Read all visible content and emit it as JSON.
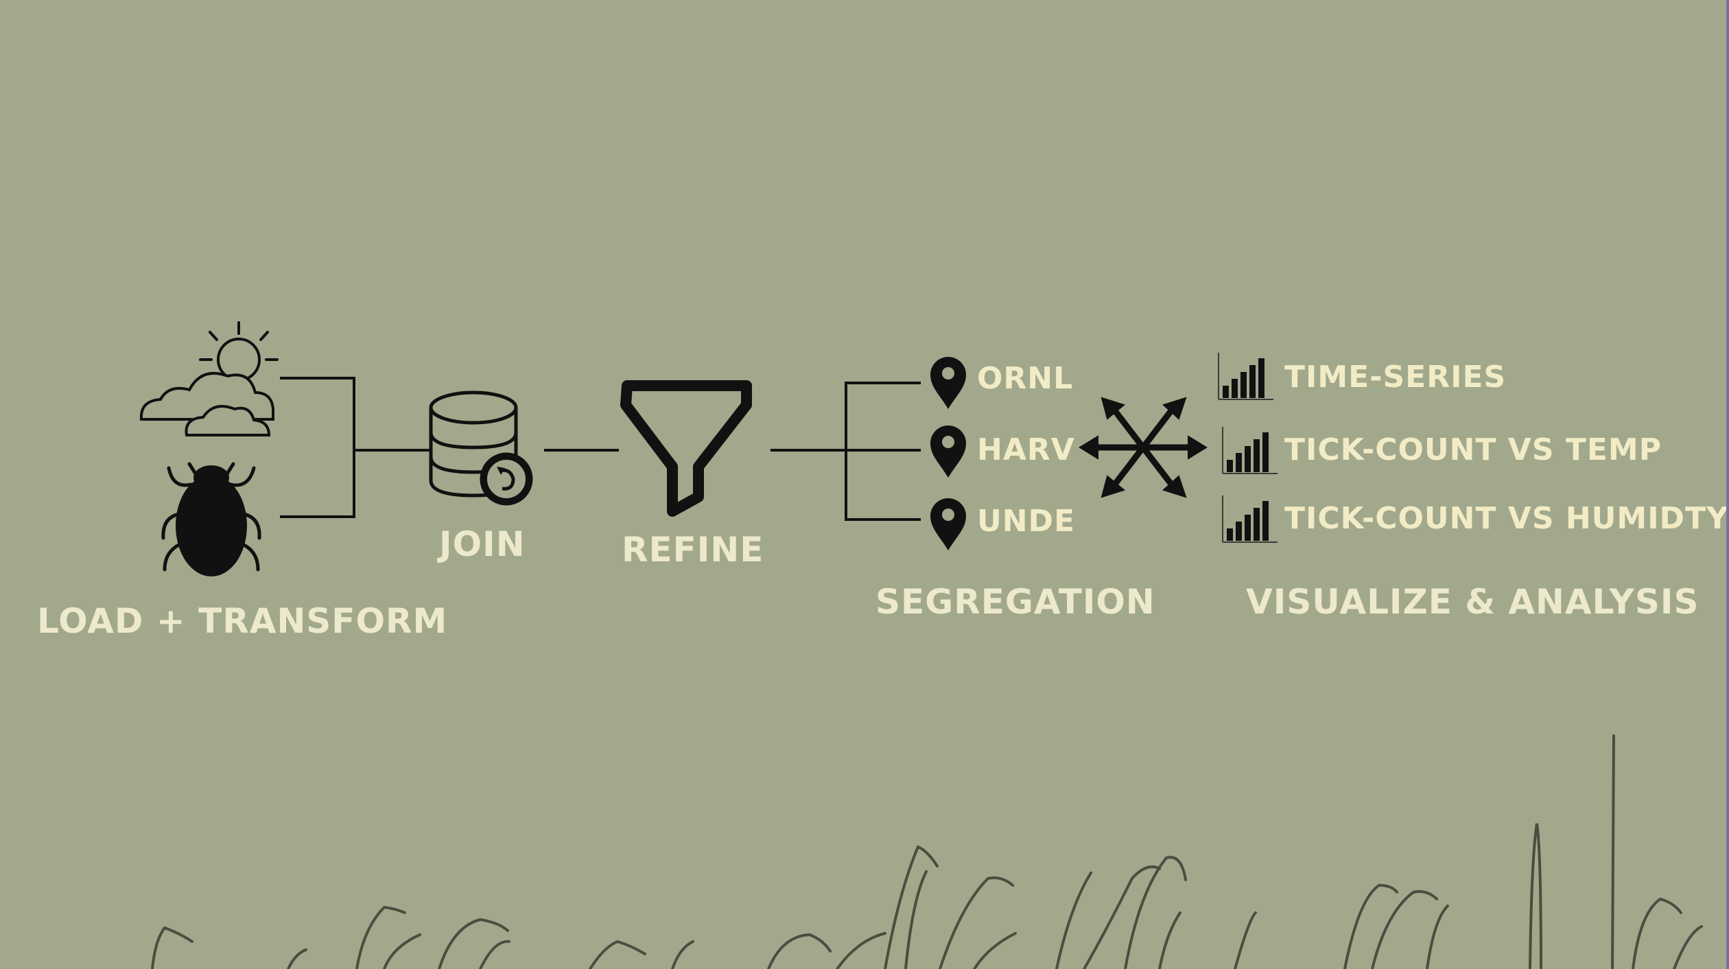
{
  "stages": {
    "load": "LOAD + TRANSFORM",
    "join": "JOIN",
    "refine": "REFINE",
    "segregation": "SEGREGATION",
    "visualize": "VISUALIZE & ANALYSIS"
  },
  "sites": [
    "ORNL",
    "HARV",
    "UNDE"
  ],
  "outputs": [
    "TIME-SERIES",
    "TICK-COUNT VS TEMP",
    "TICK-COUNT VS HUMIDTY"
  ],
  "colors": {
    "background": "#a2a88c",
    "label": "#ede9cc",
    "icon": "#0d0d0d",
    "grass": "#4a4e40"
  },
  "icons": [
    "weather-icon",
    "tick-icon",
    "database-icon",
    "filter-icon",
    "location-pin-icon",
    "expand-arrows-icon",
    "bar-chart-icon"
  ]
}
